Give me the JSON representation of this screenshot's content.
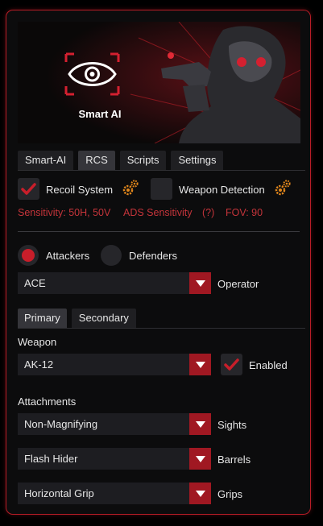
{
  "colors": {
    "accent": "#b81c26",
    "panel": "#0c0c0d",
    "control": "#1d1d21",
    "text": "#e6e6e6",
    "warn": "#c4343a",
    "gear": "#e0861c"
  },
  "banner": {
    "logo_text": "Smart AI"
  },
  "main_tabs": [
    {
      "label": "Smart-AI"
    },
    {
      "label": "RCS",
      "active": true
    },
    {
      "label": "Scripts"
    },
    {
      "label": "Settings"
    }
  ],
  "rcs": {
    "recoil_system": {
      "label": "Recoil System",
      "checked": true
    },
    "weapon_detection": {
      "label": "Weapon Detection",
      "checked": false
    },
    "sensitivity_text": "Sensitivity: 50H, 50V",
    "ads_text": "ADS Sensitivity",
    "help_text": "(?)",
    "fov_text": "FOV: 90"
  },
  "side": {
    "attackers_label": "Attackers",
    "defenders_label": "Defenders",
    "selected": "attackers"
  },
  "operator": {
    "value": "ACE",
    "label": "Operator"
  },
  "loadout_tabs": [
    {
      "label": "Primary",
      "active": true
    },
    {
      "label": "Secondary"
    }
  ],
  "weapon": {
    "section_label": "Weapon",
    "value": "AK-12",
    "enabled_label": "Enabled",
    "enabled": true
  },
  "attachments": {
    "section_label": "Attachments",
    "sights": {
      "value": "Non-Magnifying",
      "label": "Sights"
    },
    "barrels": {
      "value": "Flash Hider",
      "label": "Barrels"
    },
    "grips": {
      "value": "Horizontal Grip",
      "label": "Grips"
    }
  }
}
